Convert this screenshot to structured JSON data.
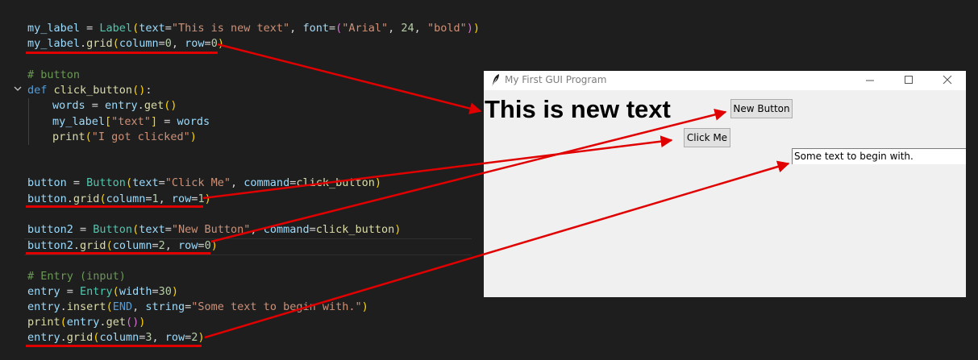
{
  "editor": {
    "lines": {
      "l1": {
        "a": "my_label",
        "b": " = ",
        "c": "Label",
        "d": "(",
        "e": "text",
        "f": "=",
        "g": "\"This is new text\"",
        "h": ", ",
        "i": "font",
        "j": "=",
        "k": "(",
        "l": "\"Arial\"",
        "m": ", ",
        "n": "24",
        "o": ", ",
        "p": "\"bold\"",
        "q": ")",
        "r": ")"
      },
      "l2": {
        "a": "my_label",
        "b": ".",
        "c": "grid",
        "d": "(",
        "e": "column",
        "f": "=",
        "g": "0",
        "h": ", ",
        "i": "row",
        "j": "=",
        "k": "0",
        "l": ")"
      },
      "l3": {
        "a": "# button"
      },
      "l4": {
        "a": "def",
        "b": " ",
        "c": "click_button",
        "d": "()",
        "e": ":"
      },
      "l5": {
        "a": "words",
        "b": " = ",
        "c": "entry",
        "d": ".",
        "e": "get",
        "f": "()"
      },
      "l6": {
        "a": "my_label",
        "b": "[",
        "c": "\"text\"",
        "d": "]",
        "e": " = ",
        "f": "words"
      },
      "l7": {
        "a": "print",
        "b": "(",
        "c": "\"I got clicked\"",
        "d": ")"
      },
      "l8": {
        "a": "button",
        "b": " = ",
        "c": "Button",
        "d": "(",
        "e": "text",
        "f": "=",
        "g": "\"Click Me\"",
        "h": ", ",
        "i": "command",
        "j": "=",
        "k": "click_button",
        "l": ")"
      },
      "l9": {
        "a": "button",
        "b": ".",
        "c": "grid",
        "d": "(",
        "e": "column",
        "f": "=",
        "g": "1",
        "h": ", ",
        "i": "row",
        "j": "=",
        "k": "1",
        "l": ")"
      },
      "l10": {
        "a": "button2",
        "b": " = ",
        "c": "Button",
        "d": "(",
        "e": "text",
        "f": "=",
        "g": "\"New Button\"",
        "h": ", ",
        "i": "command",
        "j": "=",
        "k": "click_button",
        "l": ")"
      },
      "l11": {
        "a": "button2",
        "b": ".",
        "c": "grid",
        "d": "(",
        "e": "column",
        "f": "=",
        "g": "2",
        "h": ", ",
        "i": "row",
        "j": "=",
        "k": "0",
        "l": ")"
      },
      "l12": {
        "a": "# Entry (input)"
      },
      "l13": {
        "a": "entry",
        "b": " = ",
        "c": "Entry",
        "d": "(",
        "e": "width",
        "f": "=",
        "g": "30",
        "h": ")"
      },
      "l14": {
        "a": "entry",
        "b": ".",
        "c": "insert",
        "d": "(",
        "e": "END",
        "f": ", ",
        "g": "string",
        "h": "=",
        "i": "\"Some text to begin with.\"",
        "j": ")"
      },
      "l15": {
        "a": "print",
        "b": "(",
        "c": "entry",
        "d": ".",
        "e": "get",
        "f": "()",
        "g": ")"
      },
      "l16": {
        "a": "entry",
        "b": ".",
        "c": "grid",
        "d": "(",
        "e": "column",
        "f": "=",
        "g": "3",
        "h": ", ",
        "i": "row",
        "j": "=",
        "k": "2",
        "l": ")"
      }
    }
  },
  "window": {
    "title": "My First GUI Program",
    "label_text": "This is new text",
    "new_button_label": "New Button",
    "click_button_label": "Click Me",
    "entry_value": "Some text to begin with."
  },
  "colors": {
    "annotation": "#e00000",
    "editor_bg": "#1e1e1e",
    "window_bg": "#f0f0f0"
  },
  "icons": [
    "chevron-down-icon",
    "feather-icon",
    "minimize-icon",
    "maximize-icon",
    "close-icon"
  ]
}
